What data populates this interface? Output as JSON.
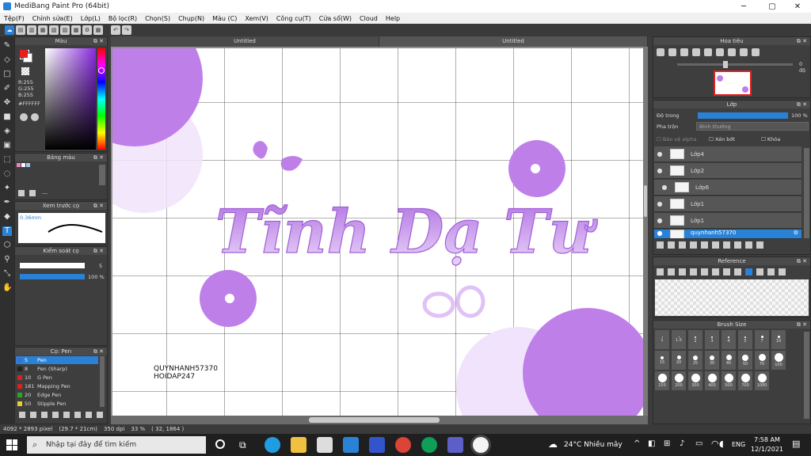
{
  "window": {
    "title": "MediBang Paint Pro (64bit)"
  },
  "menu": [
    "Tệp(F)",
    "Chỉnh sửa(E)",
    "Lớp(L)",
    "Bộ lọc(R)",
    "Chọn(S)",
    "Chụp(N)",
    "Màu (C)",
    "Xem(V)",
    "Công cụ(T)",
    "Cửa sổ(W)",
    "Cloud",
    "Help"
  ],
  "tabs": [
    "Untitled",
    "Untitled"
  ],
  "color_panel": {
    "title": "Màu",
    "r": "R:255",
    "g": "G:255",
    "b": "B:255",
    "hex": "#FFFFFF",
    "primary_color": "#e52020",
    "secondary_color": "#ffffff"
  },
  "palette_panel": {
    "title": "Bảng màu",
    "value": "---"
  },
  "brush_preview_panel": {
    "title": "Xem trước cọ",
    "size": "0.36mm"
  },
  "brush_control_panel": {
    "title": "Kiểm soát cọ",
    "size_value": "5",
    "opacity_value": "100 %",
    "size_fraction": 0.55,
    "opacity_fraction": 1.0
  },
  "brush_list_panel": {
    "title": "Cọ: Pen",
    "items": [
      {
        "num": "5",
        "name": "Pen",
        "color": "#3a6fd8"
      },
      {
        "num": "8",
        "name": "Pen (Sharp)",
        "color": "#222222"
      },
      {
        "num": "10",
        "name": "G Pen",
        "color": "#e02020"
      },
      {
        "num": "181",
        "name": "Mapping Pen",
        "color": "#e02020"
      },
      {
        "num": "20",
        "name": "Edge Pen",
        "color": "#22aa22"
      },
      {
        "num": "50",
        "name": "Stipple Pen",
        "color": "#e8d020"
      }
    ]
  },
  "navigator_panel": {
    "title": "Hoa tiêu",
    "rotation": "0 độ"
  },
  "layer_panel": {
    "title": "Lớp",
    "opacity_label": "Độ trong",
    "opacity_value": "100 %",
    "opacity_fraction": 1.0,
    "blend_label": "Pha trộn",
    "blend_value": "Bình thường",
    "protect_alpha": "Bảo vệ alpha",
    "clipping": "Xén bớt",
    "lock": "Khóa",
    "layers": [
      {
        "name": "Lớp4"
      },
      {
        "name": "Lớp2"
      },
      {
        "name": "Lớp6"
      },
      {
        "name": "Lớp1"
      },
      {
        "name": "Lớp1"
      },
      {
        "name": "quynhanh57370"
      }
    ]
  },
  "reference_panel": {
    "title": "Reference"
  },
  "brush_size_panel": {
    "title": "Brush Size",
    "sizes": [
      "1",
      "1.5",
      "2",
      "3",
      "4",
      "5",
      "7",
      "10",
      "15",
      "20",
      "25",
      "30",
      "40",
      "50",
      "70",
      "100",
      "150",
      "200",
      "300",
      "400",
      "500",
      "700",
      "1000"
    ]
  },
  "canvas_text": {
    "title": "Tĩnh Dạ Tư",
    "watermark_1": "QUYNHANH57370",
    "watermark_2": "HOIDAP247"
  },
  "status": {
    "size": "4092 * 2893 pixel",
    "paper": "(29.7 * 21cm)",
    "dpi": "350 dpi",
    "zoom": "33 %",
    "coords": "( 32, 1864 )"
  },
  "taskbar": {
    "search_placeholder": "Nhập tại đây để tìm kiếm",
    "weather": "24°C  Nhiều mây",
    "lang": "ENG",
    "time": "7:58 AM",
    "date": "12/1/2021"
  },
  "colors": {
    "accent": "#2a82d6",
    "art_purple": "#bf7fe8",
    "art_light": "#f1e3fb"
  }
}
